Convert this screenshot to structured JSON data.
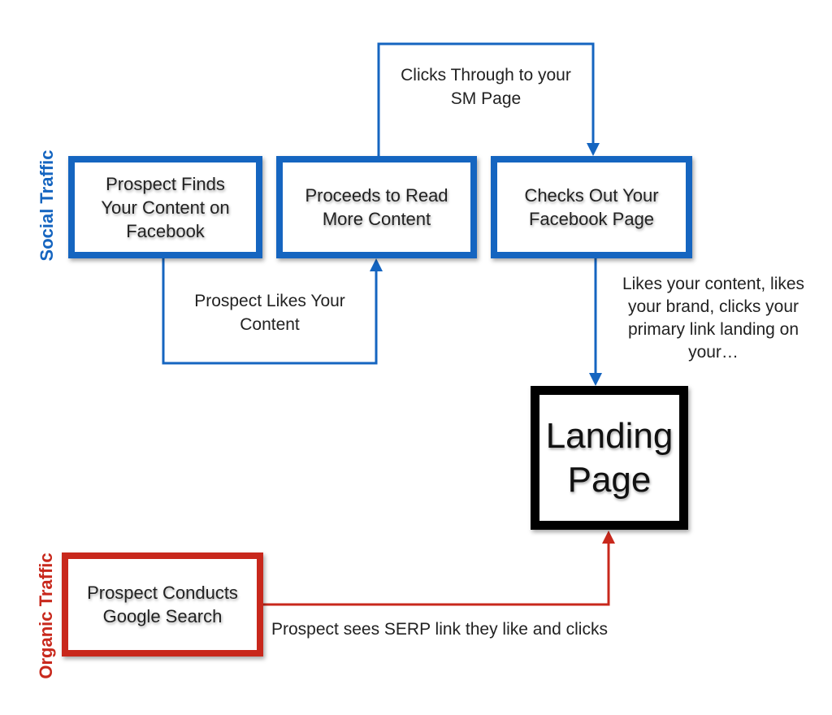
{
  "colors": {
    "social": "#1565C0",
    "organic": "#C8281C",
    "landing": "#000000"
  },
  "lanes": {
    "social": "Social Traffic",
    "organic": "Organic Traffic"
  },
  "nodes": {
    "finds_content": "Prospect Finds Your Content on Facebook",
    "reads_more": "Proceeds to Read More Content",
    "checks_page": "Checks Out Your Facebook Page",
    "landing_page": "Landing Page",
    "google_search": "Prospect Conducts Google Search"
  },
  "edges": {
    "likes_content": "Prospect Likes Your Content",
    "clicks_through": "Clicks Through to your SM Page",
    "likes_brand": "Likes your content, likes your brand, clicks your primary link landing on your…",
    "serp_click": "Prospect sees SERP link they like and clicks"
  }
}
